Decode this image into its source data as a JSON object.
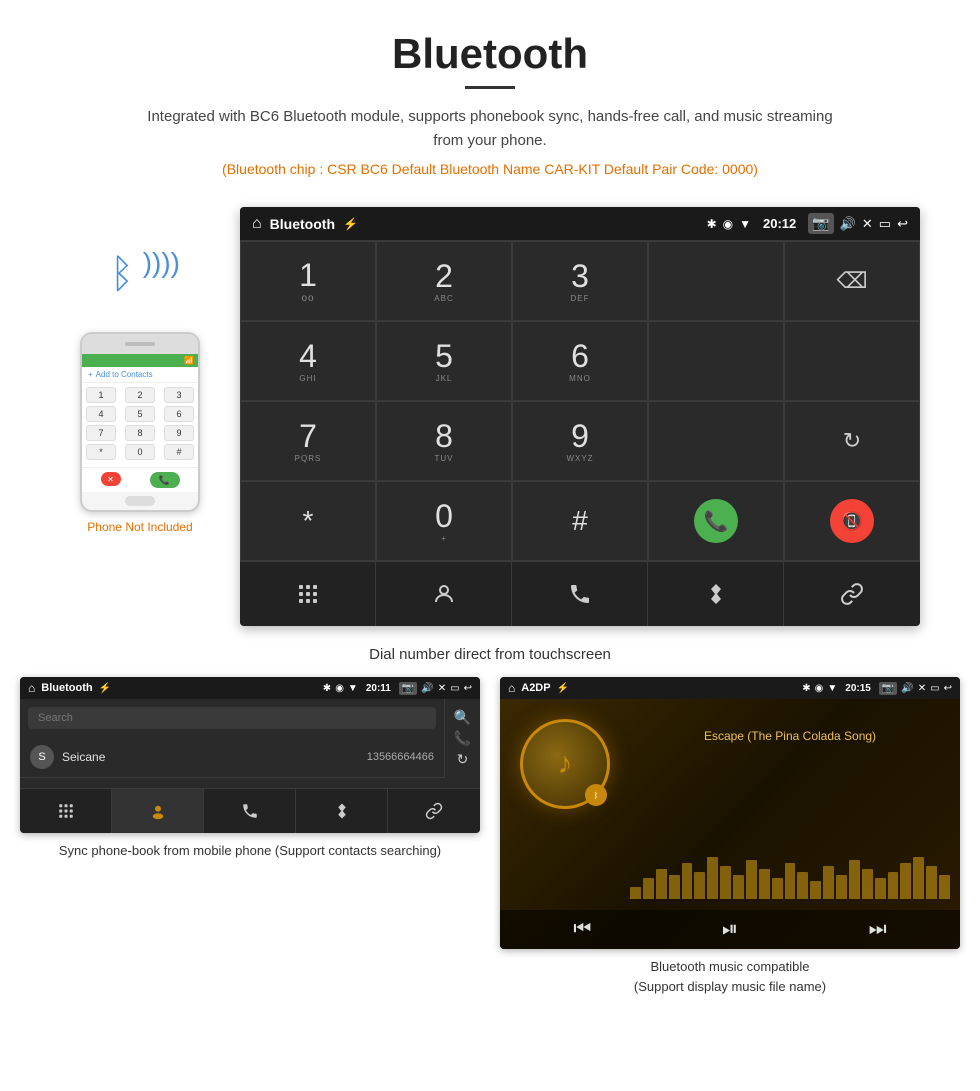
{
  "page": {
    "title": "Bluetooth",
    "divider": true,
    "description": "Integrated with BC6 Bluetooth module, supports phonebook sync, hands-free call, and music streaming from your phone.",
    "specs": "(Bluetooth chip : CSR BC6    Default Bluetooth Name CAR-KIT    Default Pair Code: 0000)",
    "caption_main": "Dial number direct from touchscreen",
    "caption_phonebook": "Sync phone-book from mobile phone\n(Support contacts searching)",
    "caption_music": "Bluetooth music compatible\n(Support display music file name)"
  },
  "phone_not_included": "Phone Not Included",
  "car_screen": {
    "title": "Bluetooth",
    "time": "20:12",
    "dialpad": [
      {
        "num": "1",
        "sub": ""
      },
      {
        "num": "2",
        "sub": "ABC"
      },
      {
        "num": "3",
        "sub": "DEF"
      },
      {
        "num": "",
        "sub": ""
      },
      {
        "num": "⌫",
        "sub": ""
      },
      {
        "num": "4",
        "sub": "GHI"
      },
      {
        "num": "5",
        "sub": "JKL"
      },
      {
        "num": "6",
        "sub": "MNO"
      },
      {
        "num": "",
        "sub": ""
      },
      {
        "num": "",
        "sub": ""
      },
      {
        "num": "7",
        "sub": "PQRS"
      },
      {
        "num": "8",
        "sub": "TUV"
      },
      {
        "num": "9",
        "sub": "WXYZ"
      },
      {
        "num": "",
        "sub": ""
      },
      {
        "num": "↻",
        "sub": ""
      },
      {
        "num": "*",
        "sub": ""
      },
      {
        "num": "0",
        "sub": "+"
      },
      {
        "num": "#",
        "sub": ""
      },
      {
        "num": "📞",
        "sub": "green"
      },
      {
        "num": "📵",
        "sub": "red"
      }
    ],
    "bottom_icons": [
      "⠿",
      "👤",
      "📞",
      "✱",
      "🔗"
    ]
  },
  "phonebook_screen": {
    "title": "Bluetooth",
    "time": "20:11",
    "search_placeholder": "Search",
    "contacts": [
      {
        "letter": "S",
        "name": "Seicane",
        "number": "13566664466"
      }
    ]
  },
  "music_screen": {
    "title": "A2DP",
    "time": "20:15",
    "track": "Escape (The Pina Colada Song)",
    "eq_bars": [
      20,
      35,
      50,
      40,
      60,
      45,
      70,
      55,
      40,
      65,
      50,
      35,
      60,
      45,
      30,
      55,
      40,
      65,
      50,
      35,
      45,
      60,
      70,
      55,
      40
    ]
  }
}
